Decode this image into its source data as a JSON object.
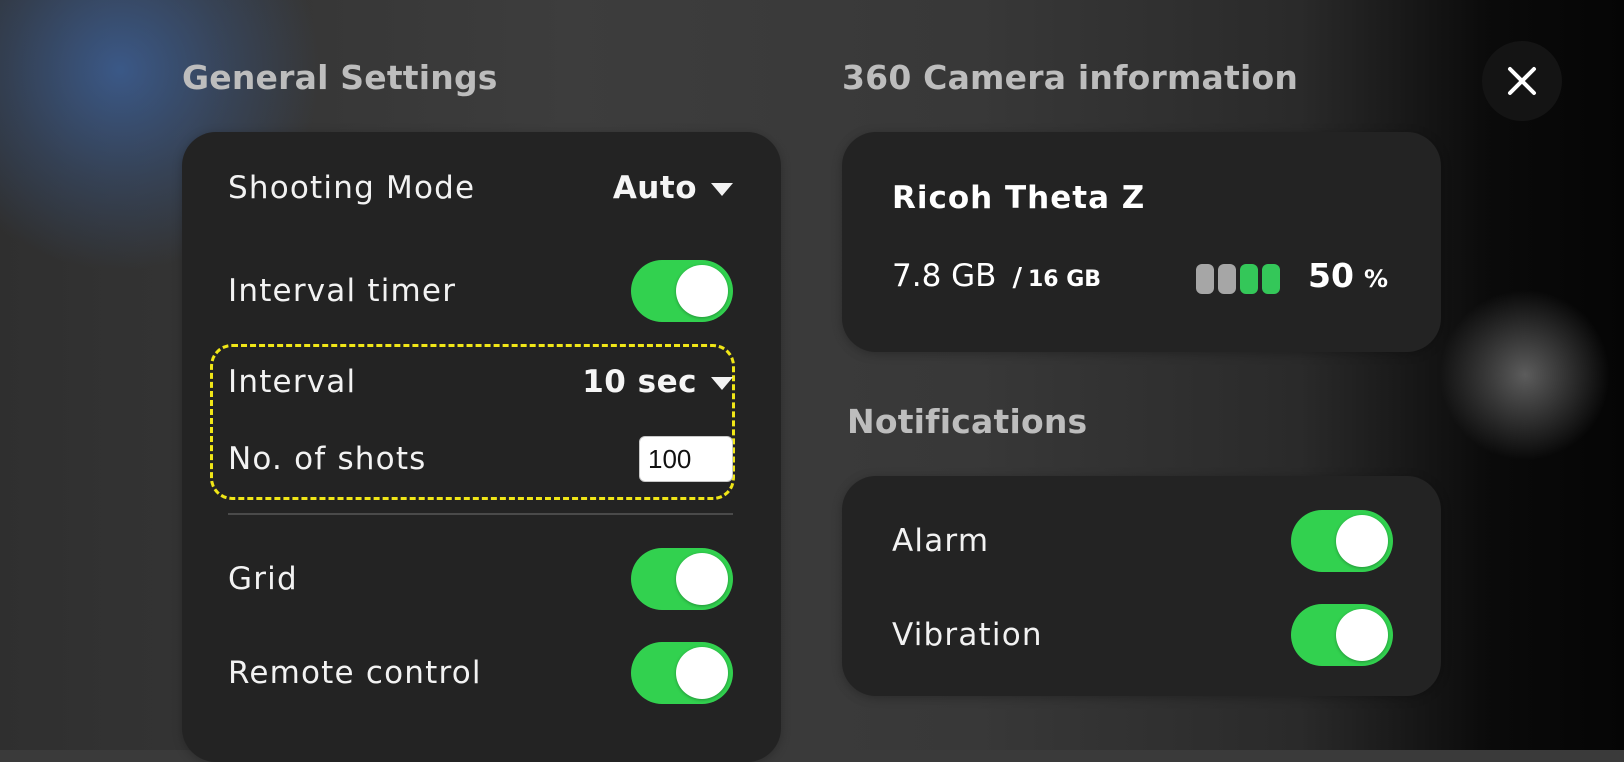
{
  "general_settings": {
    "title": "General Settings",
    "shooting_mode": {
      "label": "Shooting Mode",
      "value": "Auto"
    },
    "interval_timer": {
      "label": "Interval timer",
      "enabled": true
    },
    "interval": {
      "label": "Interval",
      "value": "10 sec"
    },
    "shots": {
      "label": "No. of shots",
      "value": "100"
    },
    "grid": {
      "label": "Grid",
      "enabled": true
    },
    "remote_control": {
      "label": "Remote control",
      "enabled": true
    }
  },
  "camera_info": {
    "title": "360 Camera information",
    "name": "Ricoh Theta Z",
    "storage_used": "7.8 GB",
    "storage_separator": "/",
    "storage_total": "16 GB",
    "battery_level": "50",
    "battery_unit": "%",
    "battery_cells": [
      "#a6a6a6",
      "#a6a6a6",
      "#34c759",
      "#34c759"
    ]
  },
  "notifications": {
    "title": "Notifications",
    "alarm": {
      "label": "Alarm",
      "enabled": true
    },
    "vibration": {
      "label": "Vibration",
      "enabled": true
    }
  },
  "colors": {
    "toggle_on": "#32d14f",
    "highlight_dashed": "#f0e617",
    "card_bg": "#232323"
  },
  "icons": {
    "close": "close-icon",
    "dropdown": "caret-down-icon"
  }
}
